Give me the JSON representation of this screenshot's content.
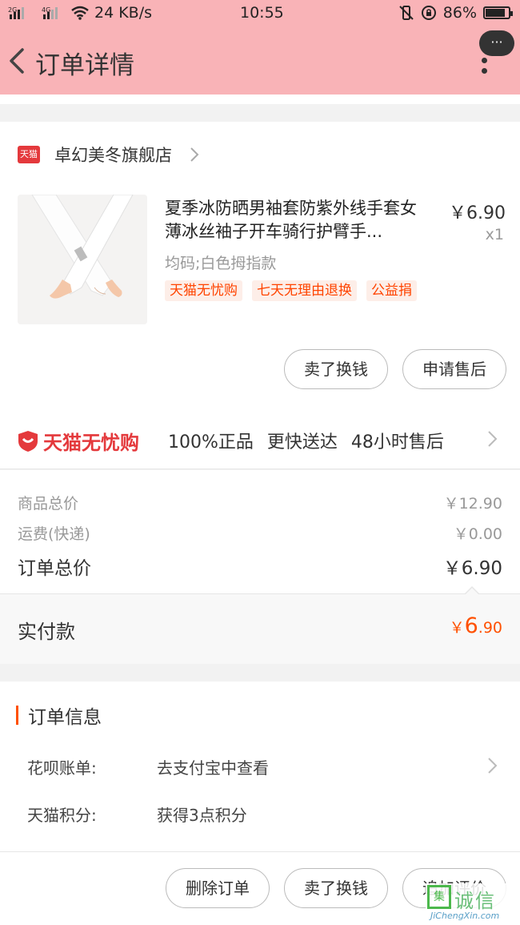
{
  "status_bar": {
    "signal_left": "2G",
    "signal_mid": "4G",
    "speed": "24 KB/s",
    "time": "10:55",
    "battery": "86%",
    "battery_level": 0.86
  },
  "nav": {
    "title": "订单详情",
    "more_bubble": "···"
  },
  "shop": {
    "badge": "天猫",
    "name": "卓幻美冬旗舰店"
  },
  "product": {
    "title": "夏季冰防晒男袖套防紫外线手套女薄冰丝袖子开车骑行护臂手...",
    "price": "￥6.90",
    "qty": "x1",
    "spec": "均码;白色拇指款",
    "tags": [
      "天猫无忧购",
      "七天无理由退换",
      "公益捐"
    ]
  },
  "item_actions": {
    "sell": "卖了换钱",
    "after_sale": "申请售后"
  },
  "guarantee": {
    "logo_text": "天猫无忧购",
    "items": "100%正品 更快送达 48小时售后"
  },
  "summary": {
    "goods_label": "商品总价",
    "goods_value": "￥12.90",
    "shipping_label": "运费(快递)",
    "shipping_value": "￥0.00",
    "total_label": "订单总价",
    "total_value": "￥6.90",
    "paid_label": "实付款",
    "paid_yen": "￥",
    "paid_int": "6",
    "paid_dec": ".90"
  },
  "order_info": {
    "title": "订单信息",
    "rows": [
      {
        "label": "花呗账单:",
        "value": "去支付宝中查看"
      },
      {
        "label": "天猫积分:",
        "value": "获得3点积分"
      }
    ]
  },
  "bottom_actions": {
    "delete": "删除订单",
    "sell": "卖了换钱",
    "review": "追加评价"
  },
  "watermark": {
    "box": "集",
    "cn": "诚信",
    "en": "JiChengXin.com"
  },
  "colors": {
    "header_bg": "#f9b3b7",
    "accent": "#ff5000",
    "tmall_red": "#e4393c"
  }
}
